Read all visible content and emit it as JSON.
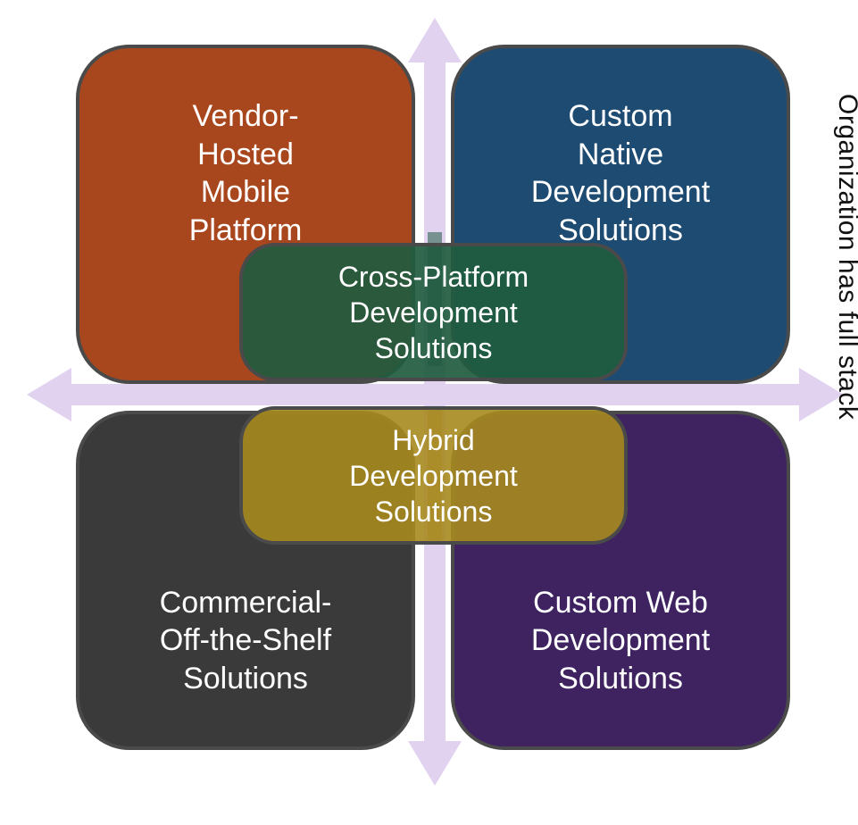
{
  "diagram": {
    "quadrants": {
      "top_left": "Vendor-\nHosted\nMobile\nPlatform",
      "top_right": "Custom\nNative\nDevelopment\nSolutions",
      "bottom_left": "Commercial-\nOff-the-Shelf\nSolutions",
      "bottom_right": "Custom Web\nDevelopment\nSolutions"
    },
    "center": {
      "upper": "Cross-Platform\nDevelopment\nSolutions",
      "lower": "Hybrid\nDevelopment\nSolutions"
    },
    "axis_labels": {
      "left": "",
      "right": "Organization has full stack"
    },
    "colors": {
      "arrow": "#e1d2f0",
      "tl": "#a8471d",
      "tr": "#1e4b72",
      "bl": "#3a3a3a",
      "br": "#3e2360",
      "pill_top": "#1f5b3f",
      "pill_bot": "#a78a1f",
      "border": "#4a4a4a"
    }
  },
  "chart_data": {
    "type": "quadrant-matrix",
    "horizontal_axis": {
      "right_end": "Organization has full stack"
    },
    "vertical_axis": {},
    "cells": [
      {
        "row": "top",
        "col": "left",
        "label": "Vendor-Hosted Mobile Platform"
      },
      {
        "row": "top",
        "col": "right",
        "label": "Custom Native Development Solutions"
      },
      {
        "row": "bottom",
        "col": "left",
        "label": "Commercial-Off-the-Shelf Solutions"
      },
      {
        "row": "bottom",
        "col": "right",
        "label": "Custom Web Development Solutions"
      }
    ],
    "overlays": [
      {
        "position": "center-upper",
        "label": "Cross-Platform Development Solutions"
      },
      {
        "position": "center-lower",
        "label": "Hybrid Development Solutions"
      }
    ]
  }
}
